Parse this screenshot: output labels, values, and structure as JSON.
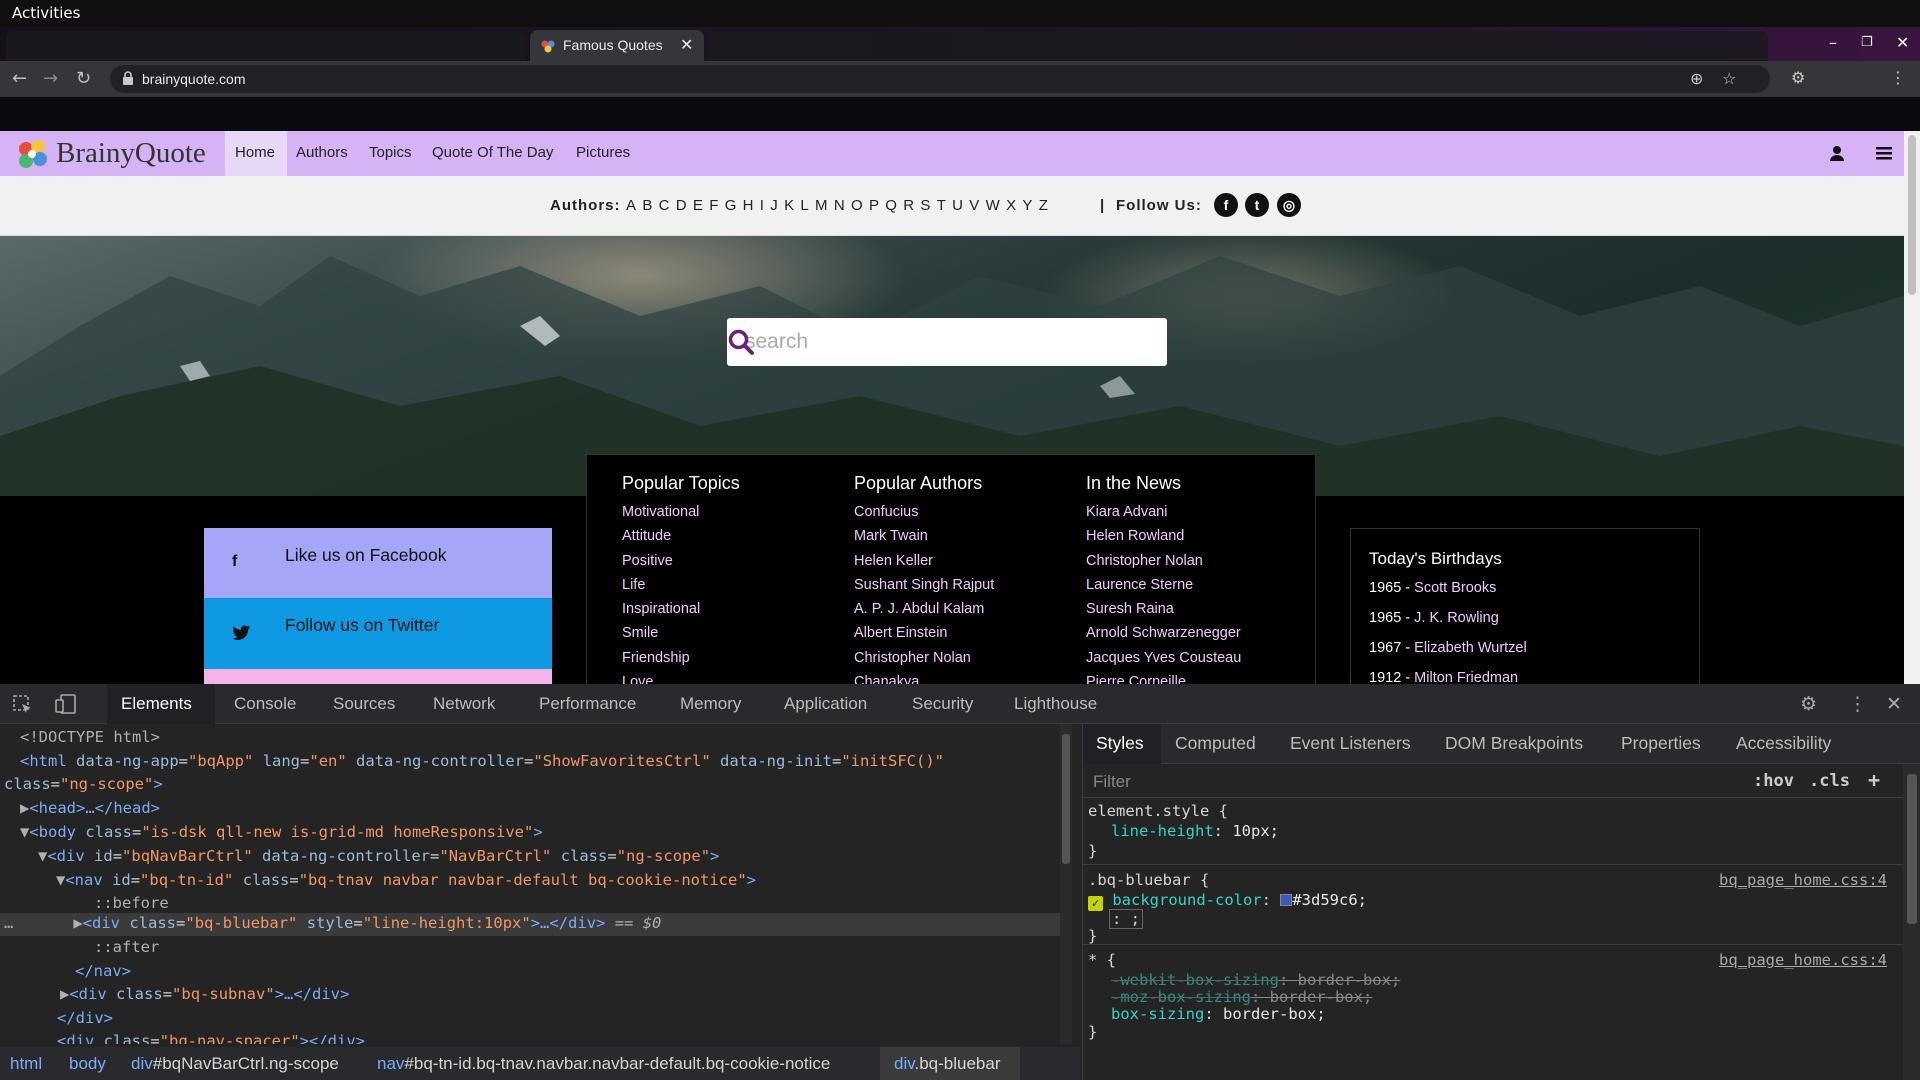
{
  "system": {
    "activities": "Activities"
  },
  "browser": {
    "tab_title": "Famous Quotes",
    "url": "brainyquote.com"
  },
  "site": {
    "logo_text": "BrainyQuote",
    "nav": [
      "Home",
      "Authors",
      "Topics",
      "Quote Of The Day",
      "Pictures"
    ],
    "authors_label": "Authors:",
    "letters": [
      "A",
      "B",
      "C",
      "D",
      "E",
      "F",
      "G",
      "H",
      "I",
      "J",
      "K",
      "L",
      "M",
      "N",
      "O",
      "P",
      "Q",
      "R",
      "S",
      "T",
      "U",
      "V",
      "W",
      "X",
      "Y",
      "Z"
    ],
    "separator": "|",
    "follow_label": "Follow Us:",
    "search_placeholder": "search",
    "popular_topics": {
      "title": "Popular Topics",
      "items": [
        "Motivational",
        "Attitude",
        "Positive",
        "Life",
        "Inspirational",
        "Smile",
        "Friendship",
        "Love"
      ]
    },
    "popular_authors": {
      "title": "Popular Authors",
      "items": [
        "Confucius",
        "Mark Twain",
        "Helen Keller",
        "Sushant Singh Rajput",
        "A. P. J. Abdul Kalam",
        "Albert Einstein",
        "Christopher Nolan",
        "Chanakya"
      ]
    },
    "in_the_news": {
      "title": "In the News",
      "items": [
        "Kiara Advani",
        "Helen Rowland",
        "Christopher Nolan",
        "Laurence Sterne",
        "Suresh Raina",
        "Arnold Schwarzenegger",
        "Jacques Yves Cousteau",
        "Pierre Corneille"
      ]
    },
    "facebook_text": "Like us on Facebook",
    "twitter_text": "Follow us on Twitter",
    "birthdays": {
      "title": "Today's Birthdays",
      "items": [
        {
          "year": "1965",
          "name": "Scott Brooks"
        },
        {
          "year": "1965",
          "name": "J. K. Rowling"
        },
        {
          "year": "1967",
          "name": "Elizabeth Wurtzel"
        },
        {
          "year": "1912",
          "name": "Milton Friedman"
        }
      ]
    },
    "colors": {
      "bluebar": "#d6b3f5",
      "facebook": "#a6a6f6",
      "twitter": "#0e9ae2",
      "pink": "#f5b3ee",
      "link": "#f4c9ff"
    }
  },
  "devtools": {
    "tabs": [
      "Elements",
      "Console",
      "Sources",
      "Network",
      "Performance",
      "Memory",
      "Application",
      "Security",
      "Lighthouse"
    ],
    "dom": {
      "doctype": "<!DOCTYPE html>",
      "html_tag": "<html",
      "html_attrs": [
        {
          "n": "data-ng-app",
          "v": "\"bqApp\""
        },
        {
          "n": "lang",
          "v": "\"en\""
        },
        {
          "n": "data-ng-controller",
          "v": "\"ShowFavoritesCtrl\""
        },
        {
          "n": "data-ng-init",
          "v": "\"initSFC()\""
        }
      ],
      "html_class_name": "class",
      "html_class_val": "\"ng-scope\"",
      "head": "<head>…</head>",
      "body_tag": "<body",
      "body_class_name": "class",
      "body_class_val": "\"is-dsk qll-new is-grid-md homeResponsive\"",
      "div_ctrl_tag": "<div",
      "div_ctrl_attrs": [
        {
          "n": "id",
          "v": "\"bqNavBarCtrl\""
        },
        {
          "n": "data-ng-controller",
          "v": "\"NavBarCtrl\""
        },
        {
          "n": "class",
          "v": "\"ng-scope\""
        }
      ],
      "nav_tag": "<nav",
      "nav_attrs": [
        {
          "n": "id",
          "v": "\"bq-tn-id\""
        },
        {
          "n": "class",
          "v": "\"bq-tnav navbar navbar-default bq-cookie-notice\""
        }
      ],
      "before": "::before",
      "sel_tag": "<div",
      "sel_class_name": "class",
      "sel_class_val": "\"bq-bluebar\"",
      "sel_style_name": "style",
      "sel_style_val": "\"line-height:10px\"",
      "sel_tail": ">…</div>",
      "sel_marker": "== $0",
      "after": "::after",
      "nav_close": "</nav>",
      "subnav_tag": "<div",
      "subnav_class_name": "class",
      "subnav_class_val": "\"bq-subnav\"",
      "subnav_tail": ">…</div>",
      "div_close": "</div>",
      "spacer_tag": "<div",
      "spacer_class_name": "class",
      "spacer_class_val": "\"bq-nav-spacer\"",
      "spacer_tail": "></div>"
    },
    "breadcrumbs": [
      {
        "tag": "html",
        "rest": ""
      },
      {
        "tag": "body",
        "rest": ""
      },
      {
        "tag": "div",
        "rest": "#bqNavBarCtrl.ng-scope"
      },
      {
        "tag": "nav",
        "rest": "#bq-tn-id.bq-tnav.navbar.navbar-default.bq-cookie-notice"
      },
      {
        "tag": "div",
        "rest": ".bq-bluebar"
      }
    ],
    "styles_tabs": [
      "Styles",
      "Computed",
      "Event Listeners",
      "DOM Breakpoints",
      "Properties",
      "Accessibility"
    ],
    "filter_placeholder": "Filter",
    "hov": ":hov",
    "cls": ".cls",
    "rules": {
      "element_style_selector": "element.style {",
      "element_style_prop": "line-height",
      "element_style_val": "10px;",
      "bluebar_selector": ".bq-bluebar {",
      "bluebar_source": "bq_page_home.css:4",
      "bluebar_prop": "background-color",
      "bluebar_val": "#3d59c6;",
      "bluebar_swatch": "#3d59c6",
      "bluebar_extra": ": ;",
      "star_selector": "* {",
      "star_source": "bq_page_home.css:4",
      "star_props": [
        {
          "p": "-webkit-box-sizing",
          "v": "border-box;",
          "struck": true
        },
        {
          "p": "-moz-box-sizing",
          "v": "border-box;",
          "struck": true
        },
        {
          "p": "box-sizing",
          "v": "border-box;",
          "struck": false
        }
      ],
      "close_brace": "}"
    }
  }
}
